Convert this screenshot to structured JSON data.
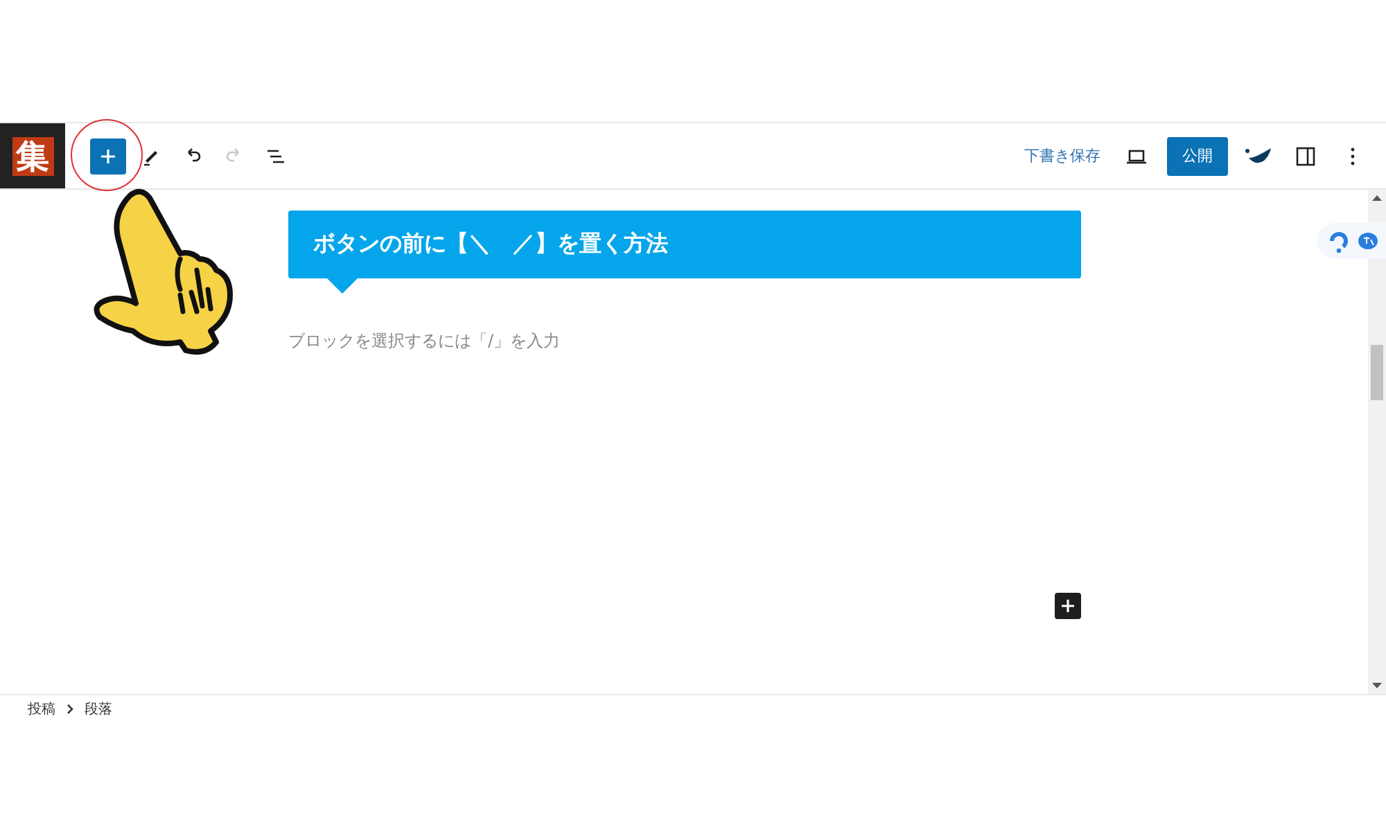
{
  "logo": {
    "text": "集"
  },
  "toolbar": {
    "redo": {
      "disabled": true
    },
    "save_draft": "下書き保存",
    "publish": "公開"
  },
  "heading": "ボタンの前に【＼　／】を置く方法",
  "paragraph": {
    "placeholder": "ブロックを選択するには「/」を入力"
  },
  "breadcrumb": [
    "投稿",
    "段落"
  ]
}
